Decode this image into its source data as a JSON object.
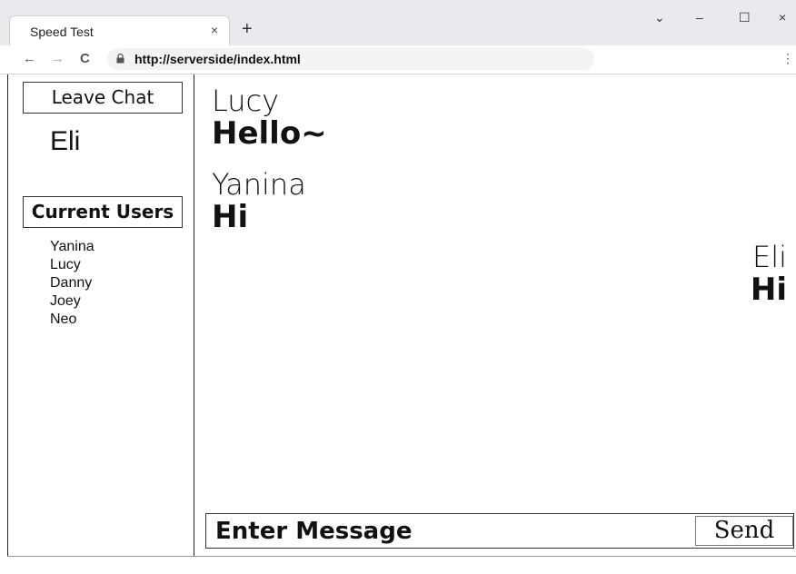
{
  "browser": {
    "tab_title": "Speed Test",
    "tab_close": "×",
    "new_tab": "+",
    "controls": {
      "dropdown": "⌄",
      "minimize": "–",
      "maximize": "☐",
      "close": "×"
    },
    "nav": {
      "back": "←",
      "forward": "→",
      "reload": "C"
    },
    "url": "http://serverside/index.html",
    "menu": "⋮"
  },
  "sidebar": {
    "leave_label": "Leave Chat",
    "username": "Eli",
    "users_header": "Current Users",
    "users": [
      "Yanina",
      "Lucy",
      "Danny",
      "Joey",
      "Neo"
    ]
  },
  "chat": {
    "messages": [
      {
        "sender": "Lucy",
        "text": "Hello~",
        "align": "left"
      },
      {
        "sender": "Yanina",
        "text": "Hi",
        "align": "left"
      },
      {
        "sender": "Eli",
        "text": "Hi",
        "align": "right"
      }
    ],
    "input_placeholder": "Enter Message",
    "send_label": "Send"
  }
}
